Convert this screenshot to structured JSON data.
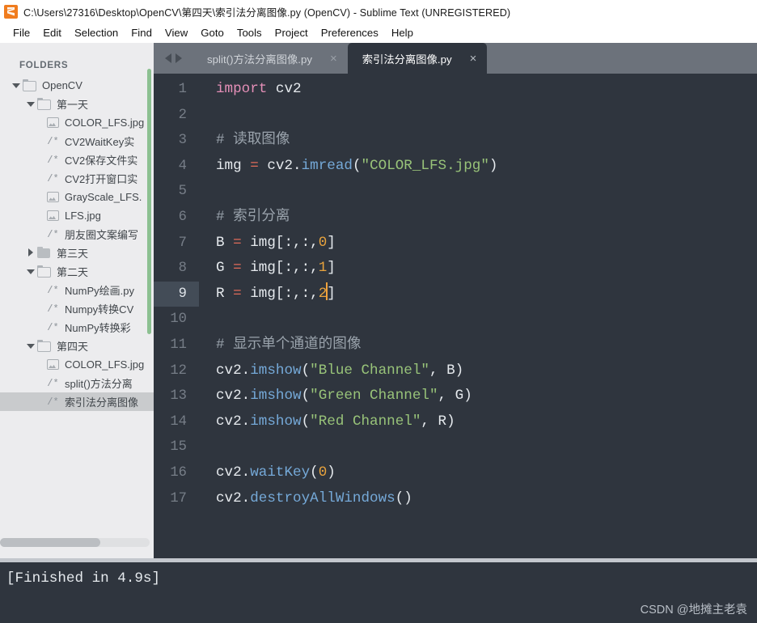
{
  "window": {
    "logo_icon": "sublime-text-logo",
    "title": "C:\\Users\\27316\\Desktop\\OpenCV\\第四天\\索引法分离图像.py (OpenCV) - Sublime Text (UNREGISTERED)"
  },
  "menubar": {
    "items": [
      {
        "label": "File"
      },
      {
        "label": "Edit"
      },
      {
        "label": "Selection"
      },
      {
        "label": "Find"
      },
      {
        "label": "View"
      },
      {
        "label": "Goto"
      },
      {
        "label": "Tools"
      },
      {
        "label": "Project"
      },
      {
        "label": "Preferences"
      },
      {
        "label": "Help"
      }
    ]
  },
  "sidebar": {
    "header": "FOLDERS",
    "tree": [
      {
        "label": "OpenCV",
        "type": "folder",
        "state": "open",
        "level": 0,
        "selected": false
      },
      {
        "label": "第一天",
        "type": "folder",
        "state": "open",
        "level": 1,
        "selected": false
      },
      {
        "label": "COLOR_LFS.jpg",
        "type": "image",
        "state": "",
        "level": 2,
        "selected": false
      },
      {
        "label": "CV2WaitKey实",
        "type": "python",
        "state": "",
        "level": 2,
        "selected": false
      },
      {
        "label": "CV2保存文件实",
        "type": "python",
        "state": "",
        "level": 2,
        "selected": false
      },
      {
        "label": "CV2打开窗口实",
        "type": "python",
        "state": "",
        "level": 2,
        "selected": false
      },
      {
        "label": "GrayScale_LFS.",
        "type": "image",
        "state": "",
        "level": 2,
        "selected": false
      },
      {
        "label": "LFS.jpg",
        "type": "image",
        "state": "",
        "level": 2,
        "selected": false
      },
      {
        "label": "朋友圈文案编写",
        "type": "python",
        "state": "",
        "level": 2,
        "selected": false
      },
      {
        "label": "第三天",
        "type": "folder",
        "state": "closed",
        "level": 1,
        "selected": false
      },
      {
        "label": "第二天",
        "type": "folder",
        "state": "open",
        "level": 1,
        "selected": false
      },
      {
        "label": "NumPy绘画.py",
        "type": "python",
        "state": "",
        "level": 2,
        "selected": false
      },
      {
        "label": "Numpy转换CV",
        "type": "python",
        "state": "",
        "level": 2,
        "selected": false
      },
      {
        "label": "NumPy转换彩",
        "type": "python",
        "state": "",
        "level": 2,
        "selected": false
      },
      {
        "label": "第四天",
        "type": "folder",
        "state": "open",
        "level": 1,
        "selected": false
      },
      {
        "label": "COLOR_LFS.jpg",
        "type": "image",
        "state": "",
        "level": 2,
        "selected": false
      },
      {
        "label": "split()方法分离",
        "type": "python",
        "state": "",
        "level": 2,
        "selected": false
      },
      {
        "label": "索引法分离图像",
        "type": "python",
        "state": "",
        "level": 2,
        "selected": true
      }
    ]
  },
  "tabs": {
    "nav_back_icon": "arrow-left-icon",
    "nav_forward_icon": "arrow-right-icon",
    "close_glyph": "×",
    "items": [
      {
        "label": "split()方法分离图像.py",
        "active": false
      },
      {
        "label": "索引法分离图像.py",
        "active": true
      }
    ]
  },
  "editor": {
    "active_line": 9,
    "lines": [
      {
        "n": "1",
        "tokens": [
          {
            "t": "import",
            "c": "kw"
          },
          {
            "t": " ",
            "c": "pl"
          },
          {
            "t": "cv2",
            "c": "mod"
          }
        ]
      },
      {
        "n": "2",
        "tokens": []
      },
      {
        "n": "3",
        "tokens": [
          {
            "t": "# 读取图像",
            "c": "com"
          }
        ]
      },
      {
        "n": "4",
        "tokens": [
          {
            "t": "img ",
            "c": "pl"
          },
          {
            "t": "=",
            "c": "op"
          },
          {
            "t": " cv2.",
            "c": "pl"
          },
          {
            "t": "imread",
            "c": "fn"
          },
          {
            "t": "(",
            "c": "pl"
          },
          {
            "t": "\"COLOR_LFS.jpg\"",
            "c": "str"
          },
          {
            "t": ")",
            "c": "pl"
          }
        ]
      },
      {
        "n": "5",
        "tokens": []
      },
      {
        "n": "6",
        "tokens": [
          {
            "t": "# 索引分离",
            "c": "com"
          }
        ]
      },
      {
        "n": "7",
        "tokens": [
          {
            "t": "B ",
            "c": "pl"
          },
          {
            "t": "=",
            "c": "op"
          },
          {
            "t": " img[:,:,",
            "c": "pl"
          },
          {
            "t": "0",
            "c": "num"
          },
          {
            "t": "]",
            "c": "pl"
          }
        ]
      },
      {
        "n": "8",
        "tokens": [
          {
            "t": "G ",
            "c": "pl"
          },
          {
            "t": "=",
            "c": "op"
          },
          {
            "t": " img[:,:,",
            "c": "pl"
          },
          {
            "t": "1",
            "c": "num"
          },
          {
            "t": "]",
            "c": "pl"
          }
        ]
      },
      {
        "n": "9",
        "tokens": [
          {
            "t": "R ",
            "c": "pl"
          },
          {
            "t": "=",
            "c": "op"
          },
          {
            "t": " img[:,:,",
            "c": "pl"
          },
          {
            "t": "2",
            "c": "num"
          },
          {
            "t": "CARET",
            "c": "caret"
          },
          {
            "t": "]",
            "c": "pl"
          }
        ]
      },
      {
        "n": "10",
        "tokens": []
      },
      {
        "n": "11",
        "tokens": [
          {
            "t": "# 显示单个通道的图像",
            "c": "com"
          }
        ]
      },
      {
        "n": "12",
        "tokens": [
          {
            "t": "cv2.",
            "c": "pl"
          },
          {
            "t": "imshow",
            "c": "fn"
          },
          {
            "t": "(",
            "c": "pl"
          },
          {
            "t": "\"Blue Channel\"",
            "c": "str"
          },
          {
            "t": ", B)",
            "c": "pl"
          }
        ]
      },
      {
        "n": "13",
        "tokens": [
          {
            "t": "cv2.",
            "c": "pl"
          },
          {
            "t": "imshow",
            "c": "fn"
          },
          {
            "t": "(",
            "c": "pl"
          },
          {
            "t": "\"Green Channel\"",
            "c": "str"
          },
          {
            "t": ", G)",
            "c": "pl"
          }
        ]
      },
      {
        "n": "14",
        "tokens": [
          {
            "t": "cv2.",
            "c": "pl"
          },
          {
            "t": "imshow",
            "c": "fn"
          },
          {
            "t": "(",
            "c": "pl"
          },
          {
            "t": "\"Red Channel\"",
            "c": "str"
          },
          {
            "t": ", R)",
            "c": "pl"
          }
        ]
      },
      {
        "n": "15",
        "tokens": []
      },
      {
        "n": "16",
        "tokens": [
          {
            "t": "cv2.",
            "c": "pl"
          },
          {
            "t": "waitKey",
            "c": "fn"
          },
          {
            "t": "(",
            "c": "pl"
          },
          {
            "t": "0",
            "c": "num"
          },
          {
            "t": ")",
            "c": "pl"
          }
        ]
      },
      {
        "n": "17",
        "tokens": [
          {
            "t": "cv2.",
            "c": "pl"
          },
          {
            "t": "destroyAllWindows",
            "c": "fn"
          },
          {
            "t": "()",
            "c": "pl"
          }
        ]
      }
    ]
  },
  "output_panel": {
    "text": "[Finished in 4.9s]"
  },
  "watermark": {
    "text": "CSDN @地摊主老袁"
  },
  "colors": {
    "editor_bg": "#2f353e",
    "tabbar_bg": "#6c727b",
    "sidebar_bg": "#ececee",
    "accent_orange": "#f07c1e",
    "keyword": "#e48fb7",
    "function": "#75a9d8",
    "string": "#98c379",
    "number": "#e8a33d",
    "operator": "#e06c5a",
    "comment": "#9aa3ac",
    "scroll_green": "#8cc091"
  }
}
